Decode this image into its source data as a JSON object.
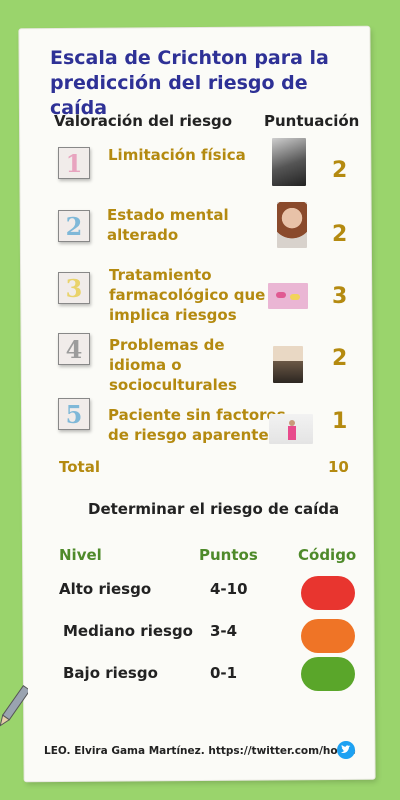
{
  "title": "Escala de Crichton para la predicción del riesgo de caída",
  "headers": {
    "left": "Valoración del riesgo",
    "right": "Puntuación"
  },
  "items": [
    {
      "number": "1",
      "label_lines": [
        "Limitación física"
      ],
      "score": "2",
      "number_color": "#e8a4bf"
    },
    {
      "number": "2",
      "label_lines": [
        "Estado mental",
        "alterado"
      ],
      "score": "2",
      "number_color": "#7fb8d8"
    },
    {
      "number": "3",
      "label_lines": [
        "Tratamiento",
        "farmacológico que",
        "implica riesgos"
      ],
      "score": "3",
      "number_color": "#e9d36b"
    },
    {
      "number": "4",
      "label_lines": [
        "Problemas de",
        "idioma o",
        "socioculturales"
      ],
      "score": "2",
      "number_color": "#9c9c9c"
    },
    {
      "number": "5",
      "label_lines": [
        "Paciente sin factores",
        "de riesgo aparente"
      ],
      "score": "1",
      "number_color": "#7fb8d8"
    }
  ],
  "total": {
    "label": "Total",
    "value": "10"
  },
  "risk_section": {
    "heading": "Determinar el riesgo de caída",
    "columns": {
      "level": "Nivel",
      "points": "Puntos",
      "code": "Código"
    },
    "rows": [
      {
        "level": "Alto riesgo",
        "points": "4-10",
        "color": "#e8352f"
      },
      {
        "level": "Mediano riesgo",
        "points": "3-4",
        "color": "#ef7426"
      },
      {
        "level": "Bajo riesgo",
        "points": "0-1",
        "color": "#5aa62a"
      }
    ]
  },
  "footer": {
    "credit": "LEO. Elvira Gama Martínez. https://twitter.com/home",
    "icon": "twitter-icon"
  },
  "colors": {
    "title": "#2e3196",
    "label": "#b48a10",
    "background": "#9ad46c"
  }
}
